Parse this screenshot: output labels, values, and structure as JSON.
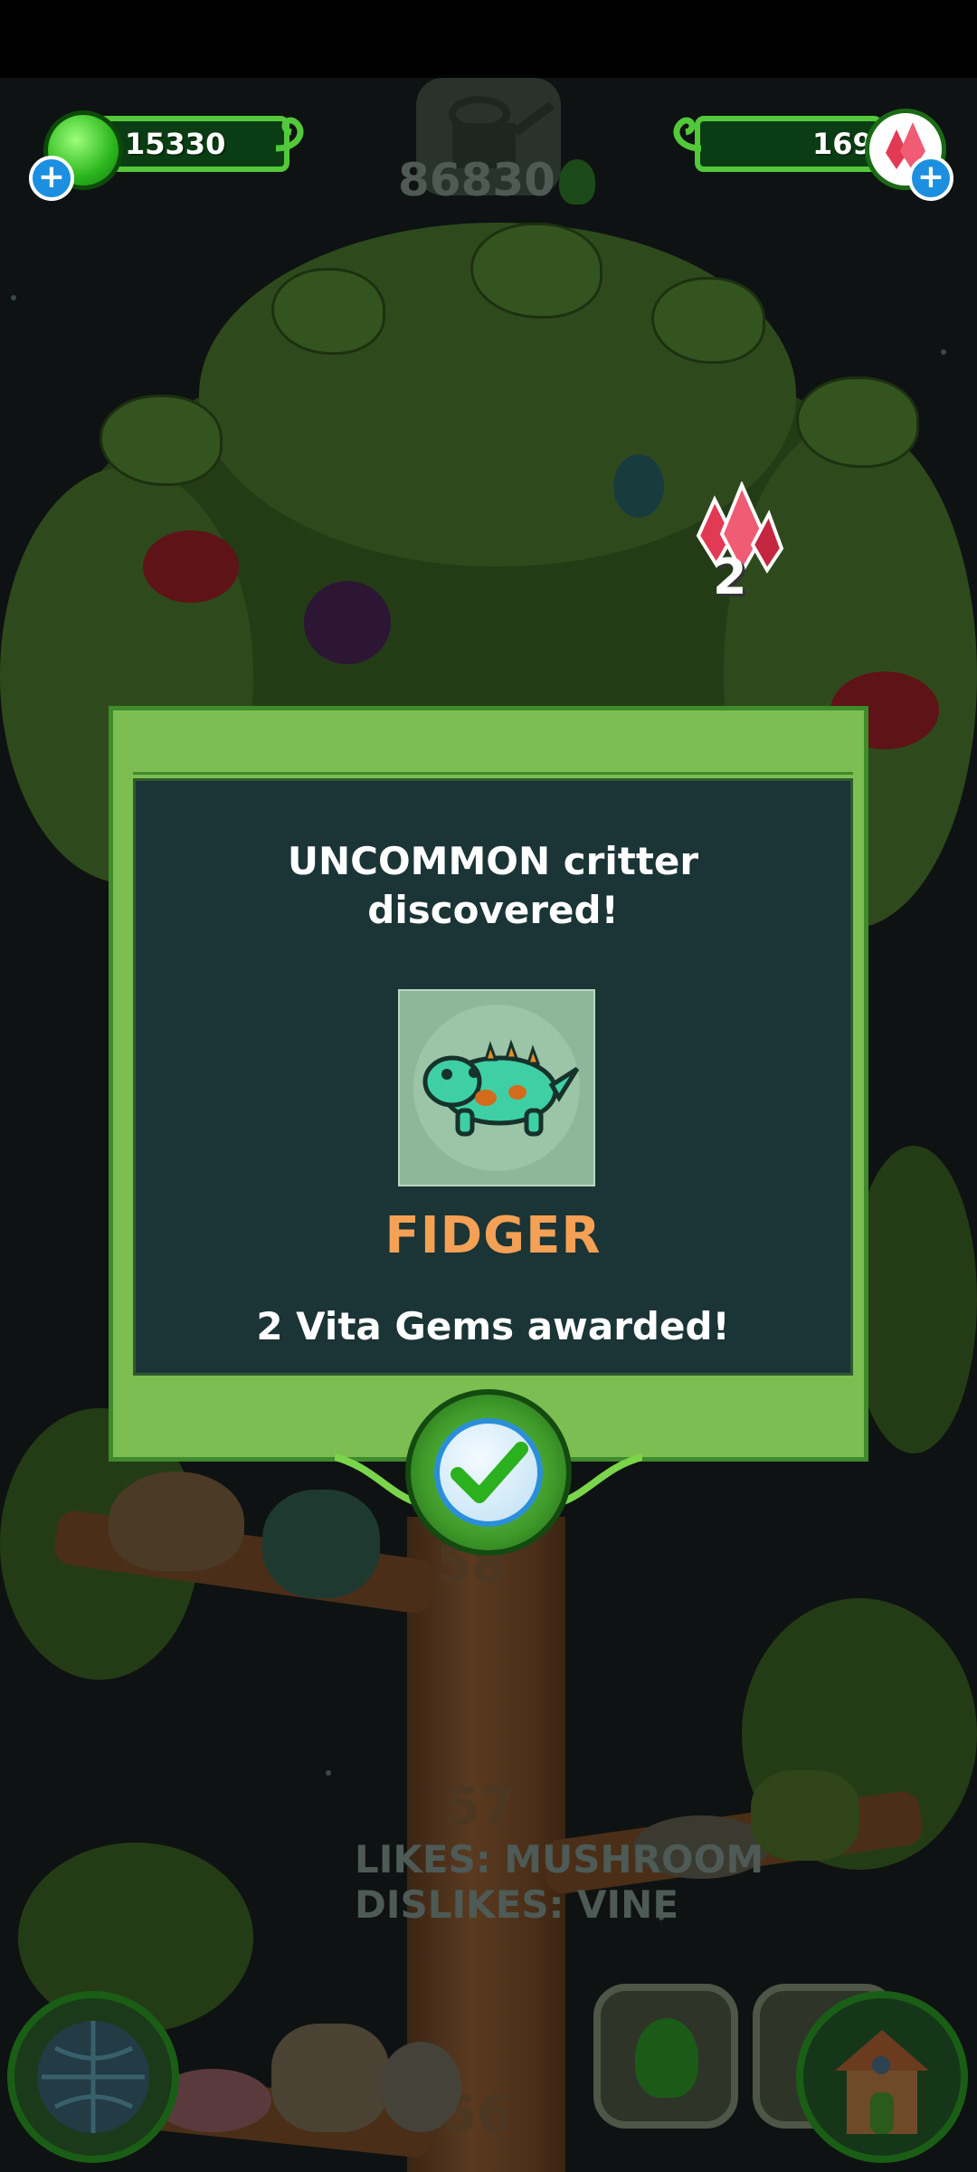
{
  "hud": {
    "slime_count": "15330",
    "gem_count": "169",
    "watering_score": "86830",
    "gem_popup_count": "2",
    "plus_symbol": "+"
  },
  "popup": {
    "title_line1": "UNCOMMON critter",
    "title_line2": "discovered!",
    "critter_name": "FIDGER",
    "reward_text": "2 Vita Gems awarded!",
    "confirm_icon": "checkmark-icon"
  },
  "tree": {
    "level_numbers": [
      "58",
      "57",
      "56"
    ],
    "likes_text": "LIKES: MUSHROOM",
    "dislikes_text": "DISLIKES: VINE"
  },
  "colors": {
    "popup_frame": "#7cbe52",
    "popup_panel": "#1b3436",
    "critter_name": "#f4a155",
    "slime_green": "#2bb61d",
    "gem_red": "#e23a54"
  },
  "icons": [
    "slime-icon",
    "plus-icon",
    "gem-icon",
    "watering-can-icon",
    "globe-icon",
    "slime-button-icon",
    "house-icon",
    "checkmark-icon"
  ]
}
